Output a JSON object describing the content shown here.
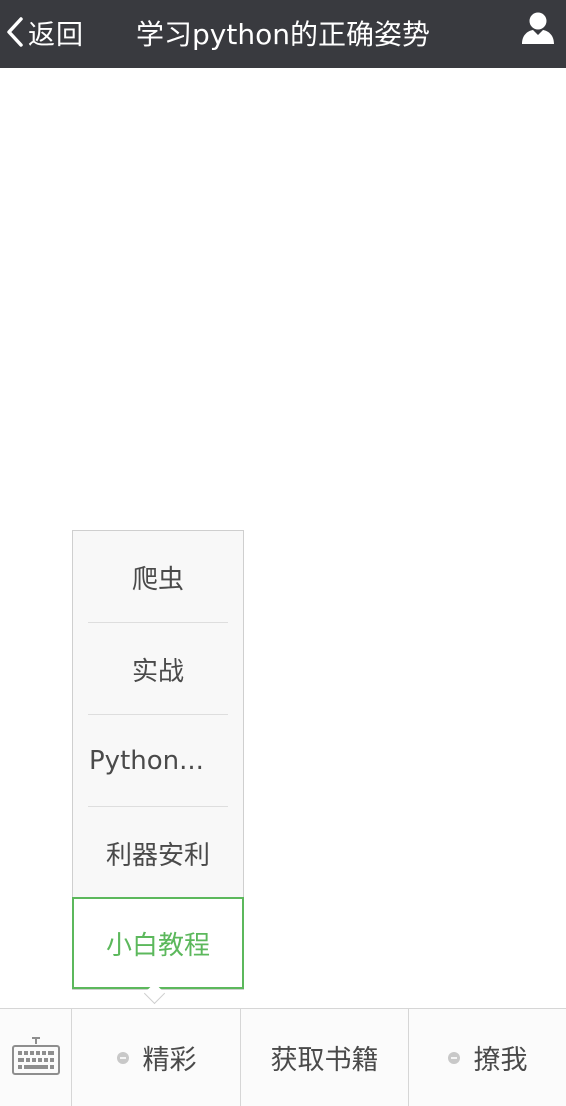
{
  "header": {
    "back_label": "返回",
    "title": "学习python的正确姿势",
    "back_icon": "chevron-left-icon",
    "profile_icon": "user-icon"
  },
  "submenu": {
    "items": [
      {
        "label": "爬虫"
      },
      {
        "label": "实战"
      },
      {
        "label": "Python..."
      },
      {
        "label": "利器安利"
      },
      {
        "label": "小白教程"
      }
    ],
    "active_color": "#5cb85c"
  },
  "bottom_menu": {
    "keyboard_icon": "keyboard-icon",
    "buttons": [
      {
        "label": "精彩",
        "has_submenu": true
      },
      {
        "label": "获取书籍",
        "has_submenu": false
      },
      {
        "label": "撩我",
        "has_submenu": true
      }
    ]
  },
  "colors": {
    "header_bg": "#393a3f",
    "accent": "#5cb85c"
  }
}
